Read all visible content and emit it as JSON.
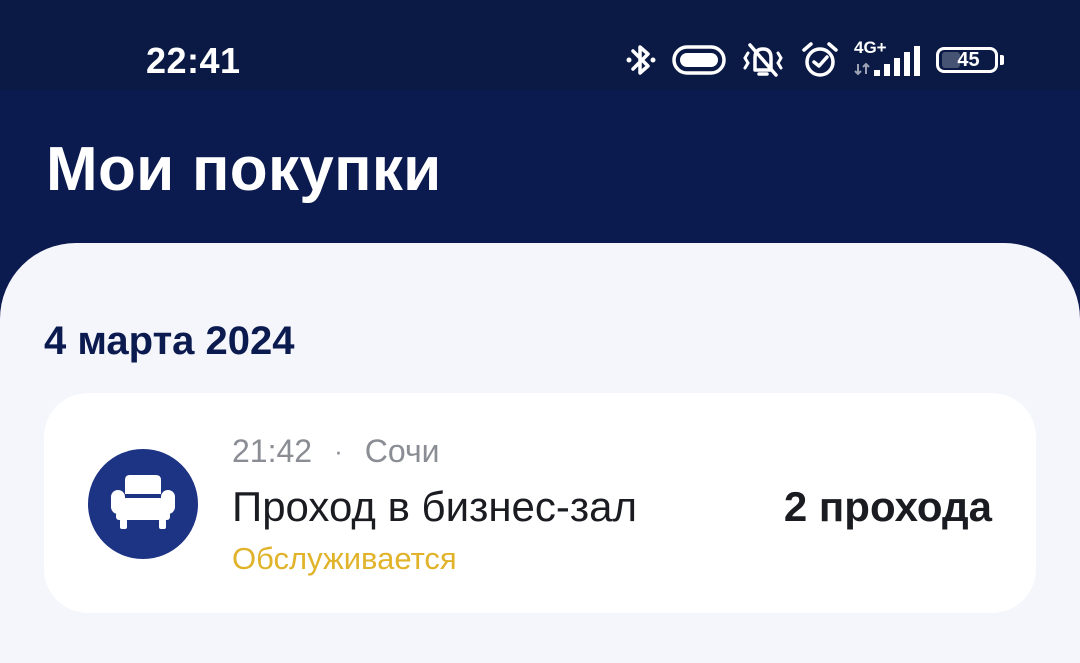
{
  "status_bar": {
    "time": "22:41",
    "network": "4G+",
    "battery": "45",
    "icons": [
      "bluetooth-icon",
      "toggle-icon",
      "vibrate-off-icon",
      "alarm-icon",
      "signal-icon",
      "battery-icon"
    ]
  },
  "header": {
    "title": "Мои покупки"
  },
  "purchases": {
    "date": "4 марта 2024",
    "items": [
      {
        "time": "21:42",
        "separator": "·",
        "city": "Сочи",
        "name": "Проход в бизнес-зал",
        "status": "Обслуживается",
        "count": "2 прохода",
        "icon": "armchair-icon"
      }
    ]
  },
  "colors": {
    "header_bg": "#0b1a4f",
    "accent": "#1d3384",
    "status_yellow": "#e0b32a",
    "content_bg": "#f4f6fb"
  }
}
